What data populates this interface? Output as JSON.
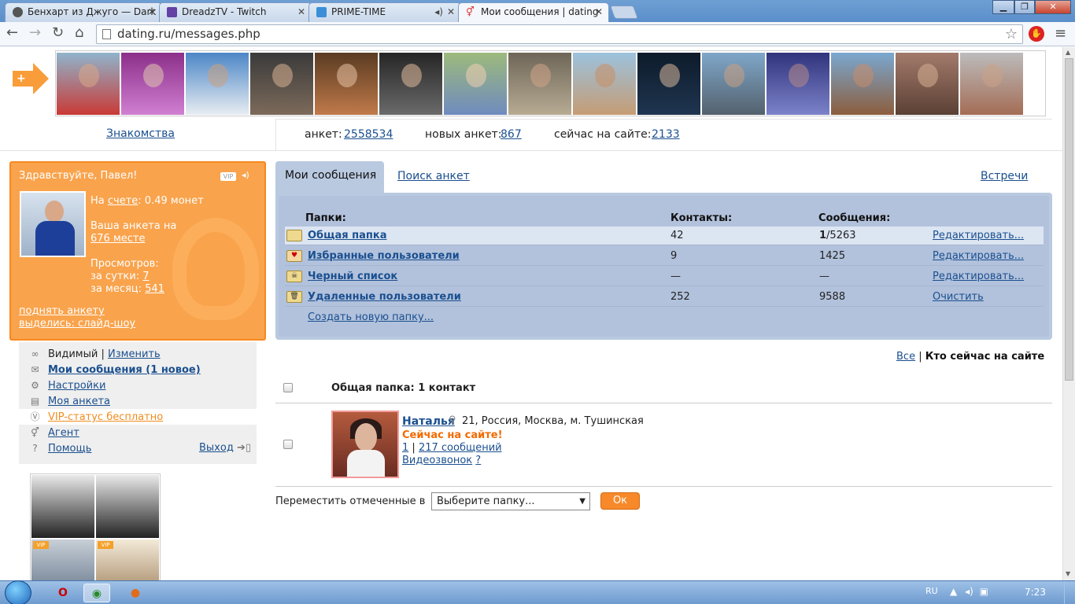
{
  "browser": {
    "tabs": [
      {
        "title": "Бенхарт из Джуго — Dark",
        "icon": "dark-souls-favicon-icon"
      },
      {
        "title": "DreadzTV - Twitch",
        "icon": "twitch-icon"
      },
      {
        "title": "PRIME-TIME",
        "icon": "prime-time-favicon-icon"
      },
      {
        "title": "Мои сообщения | dating",
        "icon": "dating-favicon-icon"
      }
    ],
    "url": "dating.ru/messages.php"
  },
  "header": {
    "znakomstva": "Знакомства",
    "stats": {
      "anket_label": "анкет:",
      "anket_value": "2558534",
      "new_label": "новых анкет:",
      "new_value": "867",
      "online_label": "сейчас на сайте:",
      "online_value": "2133"
    }
  },
  "profile": {
    "greeting": "Здравствуйте, Павел!",
    "vip_badge": "VIP",
    "balance_prefix": "На",
    "balance_link": "счете",
    "balance_value": ": 0.49 монет",
    "rank_text": "Ваша анкета на",
    "rank_link": "676 месте",
    "views_label": "Просмотров:",
    "views_day_label": "за сутки:",
    "views_day": "7",
    "views_month_label": "за месяц:",
    "views_month": "541",
    "raise_link": "поднять анкету",
    "slideshow_link": "выделись: слайд-шоу"
  },
  "menu": {
    "visible_label": "Видимый",
    "separator": "|",
    "change_link": "Изменить",
    "messages": "Мои сообщения (1 новое)",
    "settings": "Настройки",
    "my_profile": "Моя анкета",
    "vip_free": "VIP-статус бесплатно",
    "agent": "Агент",
    "help": "Помощь",
    "logout": "Выход"
  },
  "thumbs_vip": "VIP",
  "messages": {
    "tab_mine": "Мои сообщения",
    "tab_search": "Поиск анкет",
    "tab_meet": "Встречи",
    "col_folders": "Папки:",
    "col_contacts": "Контакты:",
    "col_messages": "Сообщения:",
    "folders": [
      {
        "name": "Общая папка",
        "contacts": "42",
        "unread": "1",
        "messages": "/5263",
        "action": "Редактировать..."
      },
      {
        "name": "Избранные пользователи",
        "contacts": "9",
        "unread": "",
        "messages": "1425",
        "action": "Редактировать..."
      },
      {
        "name": "Черный список",
        "contacts": "—",
        "unread": "",
        "messages": "—",
        "action": "Редактировать..."
      },
      {
        "name": "Удаленные пользователи",
        "contacts": "252",
        "unread": "",
        "messages": "9588",
        "action": "Очистить"
      }
    ],
    "new_folder": "Создать новую папку...",
    "filter_all": "Все",
    "filter_sep": "|",
    "filter_online": "Кто сейчас на сайте",
    "folder_header": "Общая папка: 1 контакт",
    "contact": {
      "name": "Наталья",
      "info": "21, Россия, Москва, м. Тушинская",
      "status": "Сейчас на сайте!",
      "new_count": "1",
      "sep": "|",
      "messages_link": "217 сообщений",
      "video_link": "Видеозвонок",
      "video_help": "?"
    },
    "move_label": "Переместить отмеченные в",
    "move_select": "Выберите папку...",
    "ok_button": "Ок"
  },
  "taskbar": {
    "lang": "RU",
    "clock": "7:23"
  },
  "colors": {
    "accent_orange": "#f9a34c",
    "panel_blue": "#b9c9e0",
    "link_blue": "#1a4f8f",
    "online_orange": "#f26a00"
  }
}
